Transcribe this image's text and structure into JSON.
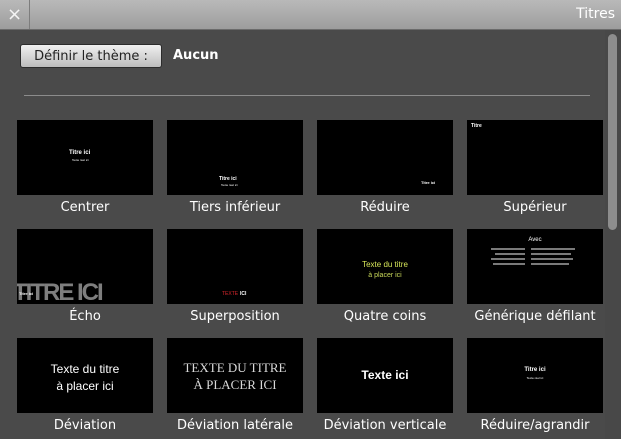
{
  "header": {
    "close_symbol": "×",
    "title": "Titres"
  },
  "theme": {
    "button_label": "Définir le thème :",
    "value": "Aucun"
  },
  "tiles": [
    {
      "label": "Centrer",
      "preview": [
        "Titre ici",
        "Texte réel ici"
      ]
    },
    {
      "label": "Tiers inférieur",
      "preview": [
        "Titre ici",
        "Texte réel ici"
      ]
    },
    {
      "label": "Réduire",
      "preview": [
        "Titre ici"
      ]
    },
    {
      "label": "Supérieur",
      "preview": [
        "Titre"
      ]
    },
    {
      "label": "Écho",
      "preview": [
        "TITRE ICI",
        "Titre ici"
      ]
    },
    {
      "label": "Superposition",
      "preview": [
        "TEXTE",
        "ICI"
      ]
    },
    {
      "label": "Quatre coins",
      "preview": [
        "Texte du titre",
        "à placer ici"
      ]
    },
    {
      "label": "Générique défilant",
      "preview": [
        "Avec"
      ]
    },
    {
      "label": "Déviation",
      "preview": [
        "Texte du titre",
        "à placer ici"
      ]
    },
    {
      "label": "Déviation latérale",
      "preview": [
        "TEXTE DU TITRE",
        "À PLACER ICI"
      ]
    },
    {
      "label": "Déviation verticale",
      "preview": [
        "Texte ici"
      ]
    },
    {
      "label": "Réduire/agrandir",
      "preview": [
        "Titre ici",
        "Texte réel ici"
      ]
    }
  ]
}
